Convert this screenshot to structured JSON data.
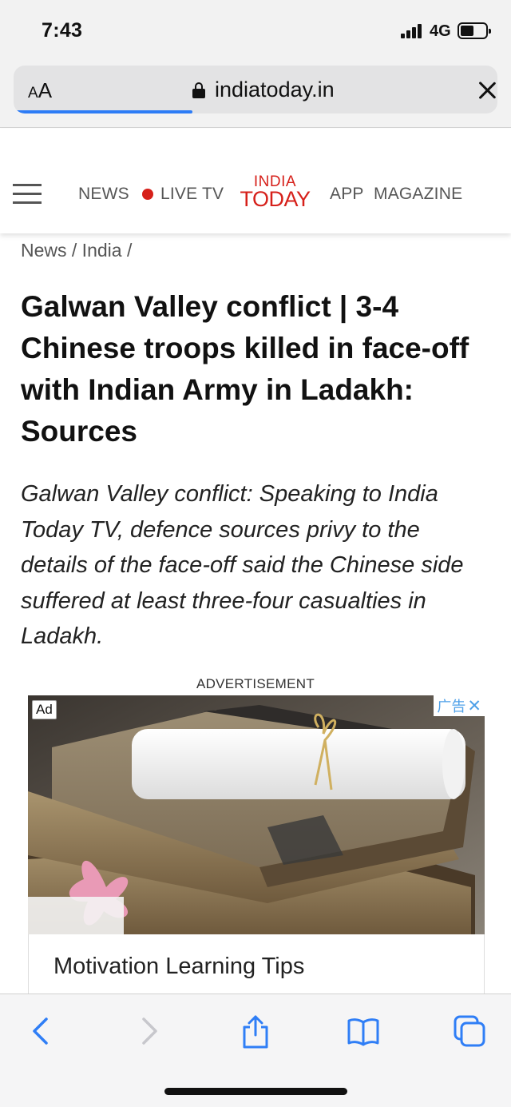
{
  "status_bar": {
    "time": "7:43",
    "network": "4G"
  },
  "browser": {
    "text_size_label": "AA",
    "url": "indiatoday.in",
    "load_progress_percent": 37,
    "accent_color": "#2d7cf6"
  },
  "site_header": {
    "nav": [
      "NEWS",
      "LIVE TV",
      "APP",
      "MAGAZINE"
    ],
    "logo_line1": "INDIA",
    "logo_line2": "TODAY",
    "brand_color": "#d6201a"
  },
  "article": {
    "breadcrumb": "News / India /",
    "headline": "Galwan Valley conflict | 3-4 Chinese troops killed in face-off with Indian Army in Ladakh: Sources",
    "summary": "Galwan Valley conflict: Speaking to India Today TV, defence sources privy to the details of the face-off said the Chinese side suffered at least three-four casualties in Ladakh."
  },
  "advertisement": {
    "label": "ADVERTISEMENT",
    "badge": "Ad",
    "adchoices_text": "广告",
    "title": "Motivation Learning Tips"
  },
  "toolbar": {
    "icons": [
      "back-icon",
      "forward-icon",
      "share-icon",
      "bookmarks-icon",
      "tabs-icon"
    ]
  }
}
